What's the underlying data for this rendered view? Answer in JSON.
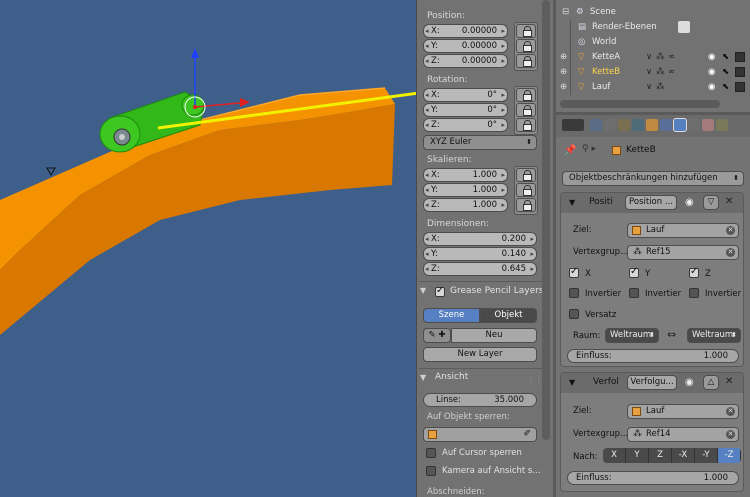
{
  "transform_panel": {
    "position_header": "Position:",
    "position": [
      {
        "axis": "X:",
        "value": "0.00000"
      },
      {
        "axis": "Y:",
        "value": "0.00000"
      },
      {
        "axis": "Z:",
        "value": "0.00000"
      }
    ],
    "rotation_header": "Rotation:",
    "rotation": [
      {
        "axis": "X:",
        "value": "0°"
      },
      {
        "axis": "Y:",
        "value": "0°"
      },
      {
        "axis": "Z:",
        "value": "0°"
      }
    ],
    "rotation_mode": "XYZ Euler",
    "scale_header": "Skalieren:",
    "scale": [
      {
        "axis": "X:",
        "value": "1.000"
      },
      {
        "axis": "Y:",
        "value": "1.000"
      },
      {
        "axis": "Z:",
        "value": "1.000"
      }
    ],
    "dimensions_header": "Dimensionen:",
    "dimensions": [
      {
        "axis": "X:",
        "value": "0.200"
      },
      {
        "axis": "Y:",
        "value": "0.140"
      },
      {
        "axis": "Z:",
        "value": "0.645"
      }
    ]
  },
  "grease_pencil": {
    "header": "Grease Pencil Layers",
    "tab_scene": "Szene",
    "tab_object": "Objekt",
    "new_button": "Neu",
    "new_layer_button": "New Layer"
  },
  "view_panel": {
    "header": "Ansicht",
    "lens_label": "Linse:",
    "lens_value": "35.000",
    "lock_label": "Auf Objekt sperren:",
    "lock_cursor": "Auf Cursor sperren",
    "lock_camera": "Kamera auf Ansicht s...",
    "clip_label": "Abschneiden:"
  },
  "outliner": {
    "scene": "Scene",
    "items": [
      {
        "name": "Render-Ebenen",
        "highlight": false
      },
      {
        "name": "World",
        "highlight": false
      },
      {
        "name": "KetteA",
        "highlight": false
      },
      {
        "name": "KetteB",
        "highlight": true
      },
      {
        "name": "Lauf",
        "highlight": false
      }
    ]
  },
  "properties": {
    "object_name": "KetteB",
    "add_constraint": "Objektbeschränkungen hinzufügen",
    "constraint1": {
      "short_name": "Positi",
      "type_button": "Position ...",
      "target_label": "Ziel:",
      "target": "Lauf",
      "vgroup_label": "Vertexgrup...",
      "vgroup": "Ref15",
      "axes": [
        {
          "label": "X",
          "checked": true
        },
        {
          "label": "Y",
          "checked": true
        },
        {
          "label": "Z",
          "checked": true
        }
      ],
      "invert_label": "Invertier",
      "offset_label": "Versatz",
      "space_label": "Raum:",
      "space_owner": "Weltraum",
      "space_target": "Weltraum",
      "influence_label": "Einfluss:",
      "influence_value": "1.000"
    },
    "constraint2": {
      "short_name": "Verfol",
      "type_button": "Verfolgu...",
      "target_label": "Ziel:",
      "target": "Lauf",
      "vgroup_label": "Vertexgrup...",
      "vgroup": "Ref14",
      "to_label": "Nach:",
      "to_axes": [
        "X",
        "Y",
        "Z",
        "-X",
        "-Y",
        "-Z"
      ],
      "to_selected": "-Z",
      "influence_label": "Einfluss:",
      "influence_value": "1.000"
    }
  },
  "colors": {
    "viewport_bg": "#3d5f8a",
    "track": "#f08a00",
    "selected_object": "#3ec41e",
    "arrow": "#f2f200",
    "highlight_text": "#ffd74a",
    "selected_tab": "#5680c2"
  }
}
